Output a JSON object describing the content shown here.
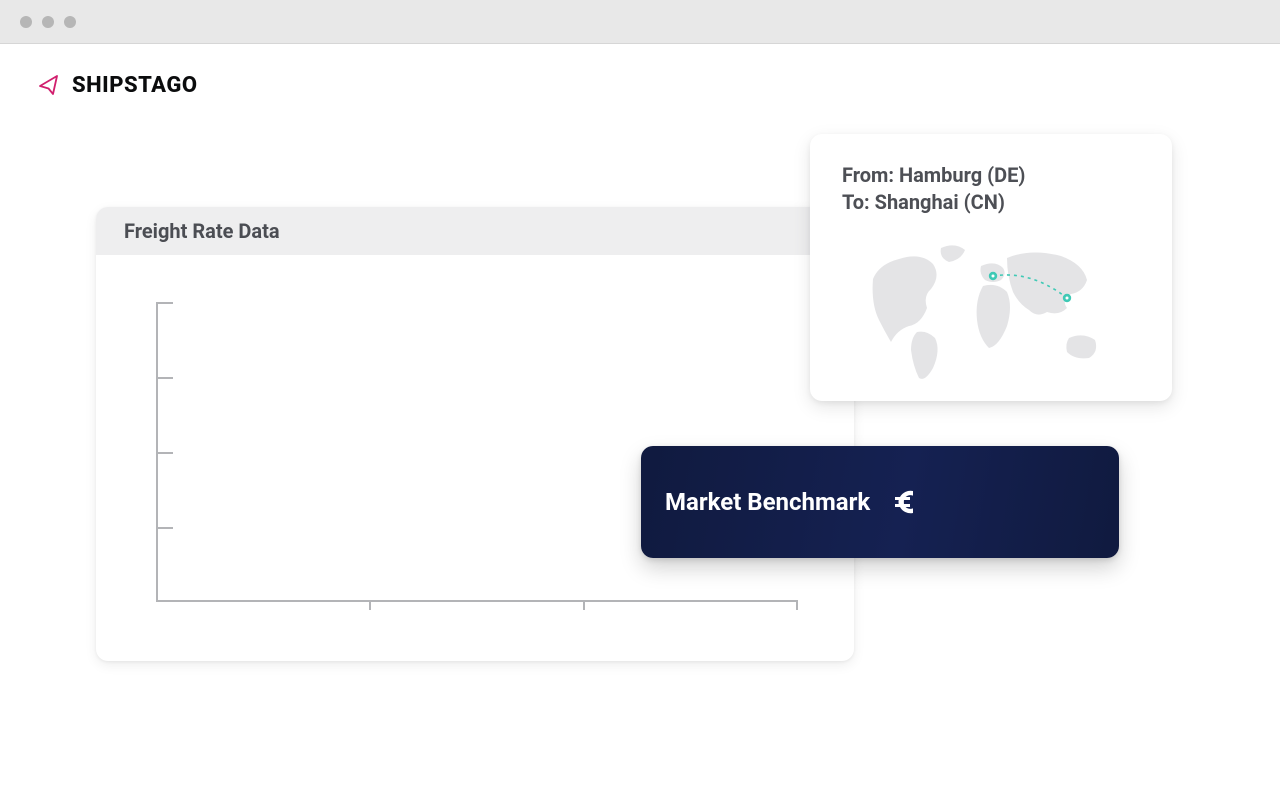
{
  "brand": {
    "name": "SHIPSTAGO"
  },
  "freight": {
    "title": "Freight Rate Data"
  },
  "route": {
    "from_label": "From:",
    "from_value": "Hamburg (DE)",
    "to_label": "To:",
    "to_value": "Shanghai (CN)"
  },
  "benchmark": {
    "label": "Market Benchmark"
  },
  "chart_data": {
    "type": "line",
    "title": "Freight Rate Data",
    "xlabel": "",
    "ylabel": "",
    "y_ticks": 4,
    "x_ticks": 3,
    "series": []
  },
  "colors": {
    "accent": "#152152",
    "brand_outline": "#d11f6e",
    "map_fill": "#e4e4e6",
    "route_marker": "#3fc9b5"
  }
}
